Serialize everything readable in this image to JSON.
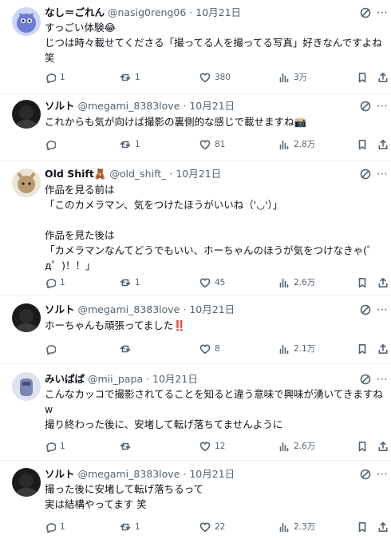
{
  "tweets": [
    {
      "name": "なし＝ごれん",
      "handle": "@nasig0reng06",
      "dot": "·",
      "date": "10月21日",
      "lines": [
        "すっごい体験😂",
        "じつは時々載せてくださる「撮ってる人を撮ってる写真」好きなんですよね",
        "笑"
      ],
      "replies": "1",
      "retweets": "1",
      "likes": "380",
      "views": "3万",
      "avatar_color": "#6b7bd6"
    },
    {
      "name": "ソルト",
      "handle": "@megami_8383love",
      "dot": "·",
      "date": "10月21日",
      "lines": [
        "これからも気が向けば撮影の裏側的な感じで載せますね📸"
      ],
      "replies": "",
      "retweets": "1",
      "likes": "81",
      "views": "2.8万",
      "avatar_color": "#2a2a2a"
    },
    {
      "name": "Old Shift🧸",
      "handle": "@old_shift_",
      "dot": "·",
      "date": "10月21日",
      "lines": [
        "作品を見る前は",
        "「このカメラマン、気をつけたほうがいいね（'◡'）」",
        "",
        "作品を見た後は",
        "「カメラマンなんてどうでもいい、ホーちゃんのほうが気をつけなきゃ(゜",
        "д゜)！！」"
      ],
      "replies": "1",
      "retweets": "1",
      "likes": "45",
      "views": "2.6万",
      "avatar_color": "#b89a6e"
    },
    {
      "name": "ソルト",
      "handle": "@megami_8383love",
      "dot": "·",
      "date": "10月21日",
      "lines": [
        "ホーちゃんも頑張ってました‼️"
      ],
      "replies": "",
      "retweets": "",
      "likes": "8",
      "views": "2.1万",
      "avatar_color": "#2a2a2a"
    },
    {
      "name": "みいぱぱ",
      "handle": "@mii_papa",
      "dot": "·",
      "date": "10月21日",
      "lines": [
        "こんなカッコで撮影されてることを知ると違う意味で興味が湧いてきますね",
        "w",
        "撮り終わった後に、安堵して転げ落ちてませんように"
      ],
      "replies": "1",
      "retweets": "",
      "likes": "12",
      "views": "2.6万",
      "avatar_color": "#7c86b0"
    },
    {
      "name": "ソルト",
      "handle": "@megami_8383love",
      "dot": "·",
      "date": "10月21日",
      "lines": [
        "撮った後に安堵して転げ落ちるって",
        "実は結構やってます 笑"
      ],
      "replies": "1",
      "retweets": "1",
      "likes": "22",
      "views": "2.3万",
      "avatar_color": "#2a2a2a"
    }
  ],
  "icons": {
    "reply": "reply-icon",
    "retweet": "retweet-icon",
    "like": "heart-icon",
    "views": "views-chart-icon",
    "bookmark": "bookmark-icon",
    "share": "share-icon",
    "grok": "grok-icon",
    "more": "more-icon"
  },
  "colors": {
    "secondary_text": "#536471",
    "divider": "#eff3f4",
    "text": "#0f1419"
  }
}
